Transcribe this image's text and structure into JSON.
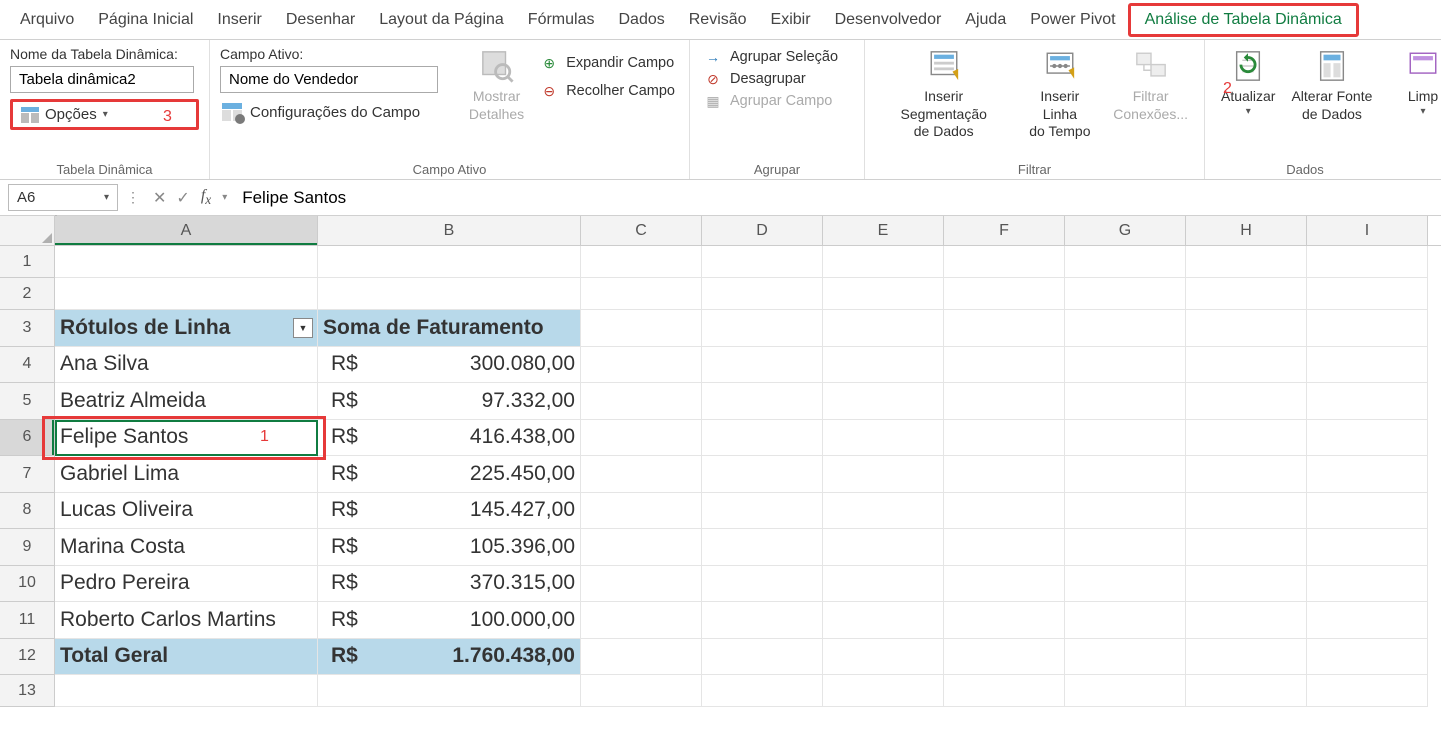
{
  "tabs": {
    "arquivo": "Arquivo",
    "inicio": "Página Inicial",
    "inserir": "Inserir",
    "desenhar": "Desenhar",
    "layout": "Layout da Página",
    "formulas": "Fórmulas",
    "dados": "Dados",
    "revisao": "Revisão",
    "exibir": "Exibir",
    "desenvolvedor": "Desenvolvedor",
    "ajuda": "Ajuda",
    "powerpivot": "Power Pivot",
    "analise": "Análise de Tabela Dinâmica"
  },
  "ribbon": {
    "nome_label": "Nome da Tabela Dinâmica:",
    "nome_value": "Tabela dinâmica2",
    "opcoes": "Opções",
    "tabela_dinamica_group": "Tabela Dinâmica",
    "campo_label": "Campo Ativo:",
    "campo_value": "Nome do Vendedor",
    "config_campo": "Configurações do Campo",
    "campo_group": "Campo Ativo",
    "mostrar_detalhes": "Mostrar\nDetalhes",
    "expandir": "Expandir Campo",
    "recolher": "Recolher Campo",
    "agrupar_sel": "Agrupar Seleção",
    "desagrupar": "Desagrupar",
    "agrupar_campo": "Agrupar Campo",
    "agrupar_group": "Agrupar",
    "inserir_seg": "Inserir Segmentação\nde Dados",
    "inserir_linha": "Inserir Linha\ndo Tempo",
    "filtrar_con": "Filtrar\nConexões...",
    "filtrar_group": "Filtrar",
    "atualizar": "Atualizar",
    "alterar_fonte": "Alterar Fonte\nde Dados",
    "limp": "Limp",
    "dados_group": "Dados"
  },
  "formula_bar": {
    "name_box": "A6",
    "value": "Felipe Santos"
  },
  "columns": [
    "A",
    "B",
    "C",
    "D",
    "E",
    "F",
    "G",
    "H",
    "I"
  ],
  "pivot": {
    "header_a": "Rótulos de Linha",
    "header_b": "Soma de Faturamento",
    "currency": "R$",
    "rows": [
      {
        "name": "Ana Silva",
        "value": "300.080,00"
      },
      {
        "name": "Beatriz Almeida",
        "value": "97.332,00"
      },
      {
        "name": "Felipe Santos",
        "value": "416.438,00"
      },
      {
        "name": "Gabriel Lima",
        "value": "225.450,00"
      },
      {
        "name": "Lucas Oliveira",
        "value": "145.427,00"
      },
      {
        "name": "Marina Costa",
        "value": "105.396,00"
      },
      {
        "name": "Pedro Pereira",
        "value": "370.315,00"
      },
      {
        "name": "Roberto Carlos Martins",
        "value": "100.000,00"
      }
    ],
    "total_label": "Total Geral",
    "total_value": "1.760.438,00"
  },
  "annotations": {
    "n1": "1",
    "n2": "2",
    "n3": "3"
  }
}
